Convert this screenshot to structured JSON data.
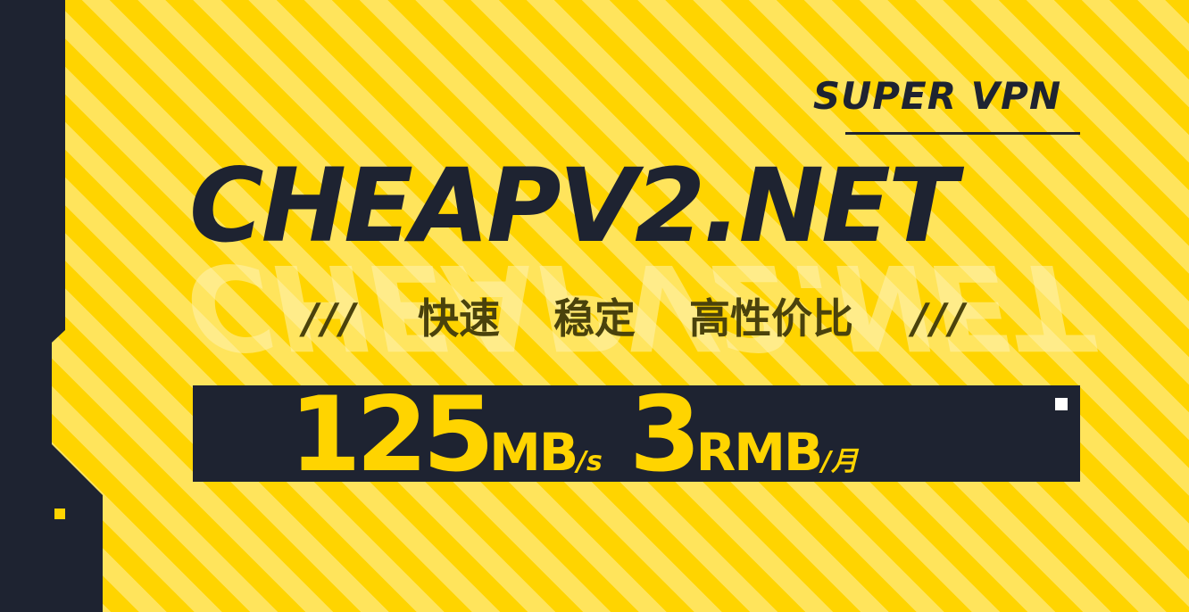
{
  "brand": {
    "tag": "SUPER VPN",
    "title": "CHEAPV2.NET",
    "watermark": "CHEAPV2.NET"
  },
  "tagline": {
    "left_slashes": "///",
    "words": [
      "快速",
      "稳定",
      "高性价比"
    ],
    "right_slashes": "///"
  },
  "price": {
    "speed_value": "125",
    "speed_unit": "MB",
    "speed_suffix": "/s",
    "cost_value": "3",
    "cost_unit": "RMB",
    "cost_suffix": "/月"
  },
  "colors": {
    "background": "#ffd400",
    "stripe": "#ffe45c",
    "dark": "#1e2331",
    "accent": "#ffd400"
  }
}
